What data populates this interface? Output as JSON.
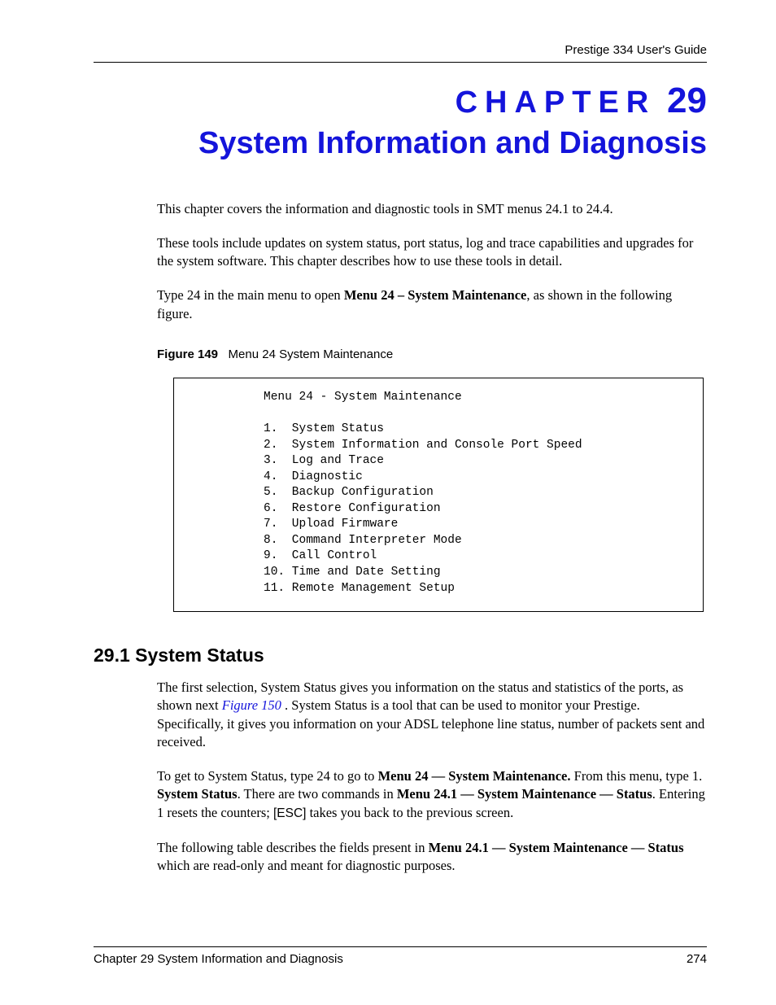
{
  "running_head": "Prestige 334 User's Guide",
  "chapter": {
    "label": "CHAPTER",
    "number": "29",
    "title": "System Information and Diagnosis"
  },
  "intro": {
    "p1": "This chapter covers the information and diagnostic tools in SMT menus 24.1 to 24.4.",
    "p2": "These tools include updates on system status, port status, log and trace capabilities and upgrades for the system software. This chapter describes how to use these tools in detail.",
    "p3_pre": "Type 24 in the main menu to open ",
    "p3_bold": "Menu 24 – System Maintenance",
    "p3_post": ", as shown in the following figure."
  },
  "figure": {
    "label": "Figure 149",
    "caption": "Menu 24 System Maintenance",
    "terminal": "Menu 24 - System Maintenance\n\n1.  System Status\n2.  System Information and Console Port Speed\n3.  Log and Trace\n4.  Diagnostic\n5.  Backup Configuration\n6.  Restore Configuration\n7.  Upload Firmware\n8.  Command Interpreter Mode\n9.  Call Control\n10. Time and Date Setting\n11. Remote Management Setup"
  },
  "section": {
    "heading": "29.1  System Status",
    "p1_pre": "The first selection, System Status gives you information on the status and statistics of the ports, as shown next ",
    "p1_link": "Figure 150 ",
    "p1_post": ". System Status is a tool that can be used to monitor your Prestige. Specifically, it gives you information on your ADSL telephone line status, number of packets sent and received.",
    "p2_a": "To get to System Status, type 24 to go to ",
    "p2_b": "Menu 24 — System Maintenance.",
    "p2_c": " From this menu, type 1. ",
    "p2_d": "System Status",
    "p2_e": ". There are two commands in ",
    "p2_f": "Menu 24.1 — System Maintenance — Status",
    "p2_g": ". Entering 1 resets the counters; ",
    "p2_h": "[ESC]",
    "p2_i": " takes you back to the previous screen.",
    "p3_a": "The following table describes the fields present in ",
    "p3_b": "Menu 24.1 — System Maintenance — Status",
    "p3_c": " which are read-only and meant for diagnostic purposes."
  },
  "footer": {
    "left": "Chapter 29 System Information and Diagnosis",
    "right": "274"
  }
}
